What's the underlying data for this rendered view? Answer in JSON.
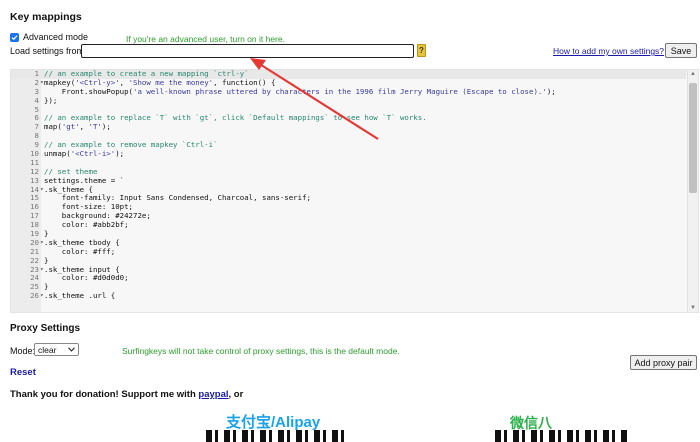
{
  "key_mappings": {
    "title": "Key mappings",
    "advanced_mode_label": "Advanced mode",
    "advanced_mode_checked": true,
    "advanced_hint": "If you're an advanced user, turn on it here.",
    "load_settings_label": "Load settings from:",
    "load_settings_value": "",
    "question_icon": "?",
    "help_link": "How to add my own settings?",
    "save_label": "Save"
  },
  "editor": {
    "lines": [
      {
        "n": "1",
        "fold": "",
        "html": "<span class=\"cmt\">// an example to create a new mapping `ctrl-y`</span>"
      },
      {
        "n": "2",
        "fold": "▾",
        "html": "mapkey(<span class=\"str\">'&lt;Ctrl-y&gt;'</span>, <span class=\"str\">'Show me the money'</span>, function() {"
      },
      {
        "n": "3",
        "fold": "",
        "html": "    Front.showPopup(<span class=\"str\">'a well-known phrase uttered by characters in the 1996 film Jerry Maguire (Escape to close).'</span>);"
      },
      {
        "n": "4",
        "fold": "",
        "html": "});"
      },
      {
        "n": "5",
        "fold": "",
        "html": ""
      },
      {
        "n": "6",
        "fold": "",
        "html": "<span class=\"cmt\">// an example to replace `T` with `gt`, click `Default mappings` to see how `T` works.</span>"
      },
      {
        "n": "7",
        "fold": "",
        "html": "map(<span class=\"str\">'gt'</span>, <span class=\"str\">'T'</span>);"
      },
      {
        "n": "8",
        "fold": "",
        "html": ""
      },
      {
        "n": "9",
        "fold": "",
        "html": "<span class=\"cmt\">// an example to remove mapkey `Ctrl-i`</span>"
      },
      {
        "n": "10",
        "fold": "",
        "html": "unmap(<span class=\"str\">'&lt;Ctrl-i&gt;'</span>);"
      },
      {
        "n": "11",
        "fold": "",
        "html": ""
      },
      {
        "n": "12",
        "fold": "",
        "html": "<span class=\"cmt\">// set theme</span>"
      },
      {
        "n": "13",
        "fold": "",
        "html": "settings.theme = `"
      },
      {
        "n": "14",
        "fold": "▾",
        "html": ".sk_theme {"
      },
      {
        "n": "15",
        "fold": "",
        "html": "    font-family: Input Sans Condensed, Charcoal, sans-serif;"
      },
      {
        "n": "16",
        "fold": "",
        "html": "    font-size: 10pt;"
      },
      {
        "n": "17",
        "fold": "",
        "html": "    background: #24272e;"
      },
      {
        "n": "18",
        "fold": "",
        "html": "    color: #abb2bf;"
      },
      {
        "n": "19",
        "fold": "",
        "html": "}"
      },
      {
        "n": "20",
        "fold": "▾",
        "html": ".sk_theme tbody {"
      },
      {
        "n": "21",
        "fold": "",
        "html": "    color: #fff;"
      },
      {
        "n": "22",
        "fold": "",
        "html": "}"
      },
      {
        "n": "23",
        "fold": "▾",
        "html": ".sk_theme input {"
      },
      {
        "n": "24",
        "fold": "",
        "html": "    color: #d0d0d0;"
      },
      {
        "n": "25",
        "fold": "",
        "html": "}"
      },
      {
        "n": "26",
        "fold": "▾",
        "html": ".sk_theme .url {"
      }
    ]
  },
  "proxy": {
    "title": "Proxy Settings",
    "mode_label": "Mode:",
    "mode_value": "clear",
    "mode_hint": "Surfingkeys will not take control of proxy settings, this is the default mode.",
    "add_proxy_label": "Add proxy pair",
    "reset_label": "Reset"
  },
  "donation": {
    "text_before": "Thank you for donation! Support me with ",
    "paypal_link": "paypal",
    "text_after": ", or",
    "alipay_label": "支付宝/Alipay",
    "wechat_label": "微信八"
  },
  "icons": {
    "checkbox": "check-icon",
    "select_arrow": "chevron-down-icon",
    "annotation": "red-arrow"
  },
  "colors": {
    "link": "#1a1aa6",
    "hint_green": "#2e9d2e",
    "arrow_red": "#e53935",
    "alipay_blue": "#1aa3e8",
    "wechat_green": "#2bb24c"
  }
}
